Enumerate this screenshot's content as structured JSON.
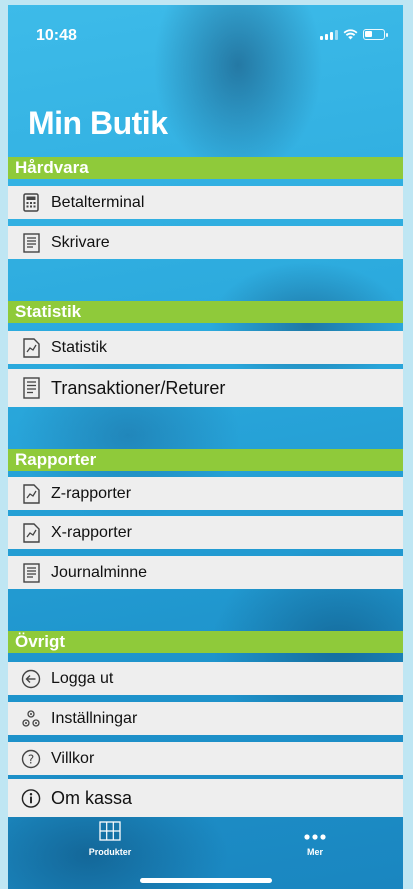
{
  "status_bar": {
    "time": "10:48"
  },
  "title": "Min Butik",
  "sections": [
    {
      "title": "Hårdvara",
      "items": [
        {
          "label": "Betalterminal",
          "icon": "calculator-icon"
        },
        {
          "label": "Skrivare",
          "icon": "receipt-icon"
        }
      ]
    },
    {
      "title": "Statistik",
      "items": [
        {
          "label": "Statistik",
          "icon": "chart-document-icon"
        },
        {
          "label": "Transaktioner/Returer",
          "icon": "receipt-icon"
        }
      ]
    },
    {
      "title": "Rapporter",
      "items": [
        {
          "label": "Z-rapporter",
          "icon": "chart-document-icon"
        },
        {
          "label": "X-rapporter",
          "icon": "chart-document-icon"
        },
        {
          "label": "Journalminne",
          "icon": "receipt-icon"
        }
      ]
    },
    {
      "title": "Övrigt",
      "items": [
        {
          "label": "Logga ut",
          "icon": "back-arrow-circle-icon"
        },
        {
          "label": "Inställningar",
          "icon": "gears-icon"
        },
        {
          "label": "Villkor",
          "icon": "question-circle-icon"
        },
        {
          "label": "Om kassa",
          "icon": "info-circle-icon"
        }
      ]
    }
  ],
  "tabbar": {
    "products": {
      "label": "Produkter",
      "icon": "grid-icon"
    },
    "more": {
      "label": "Mer",
      "icon": "more-dots-icon"
    }
  },
  "colors": {
    "section_header": "#8fca3a",
    "row_background": "#eeeeee",
    "background": "#2aa8dc"
  }
}
